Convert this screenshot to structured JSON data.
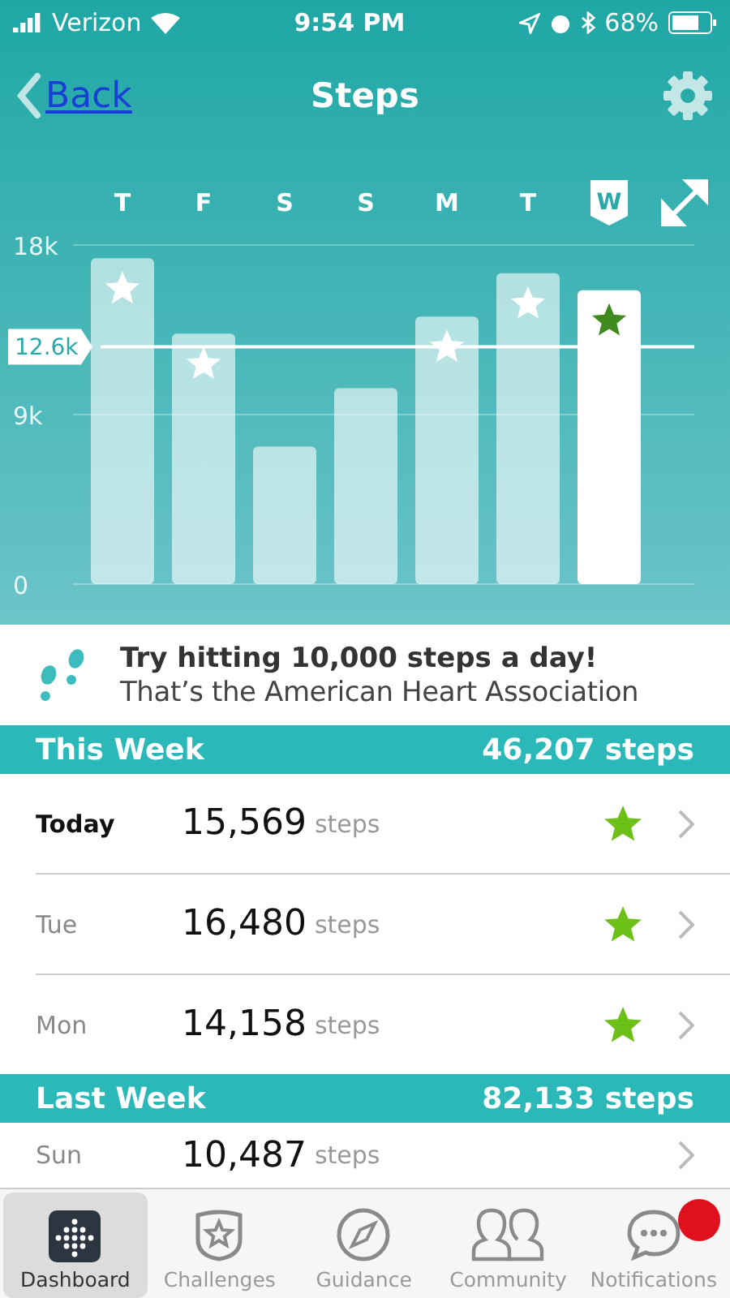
{
  "status_bar": {
    "carrier": "Verizon",
    "time": "9:54 PM",
    "battery": "68%"
  },
  "nav": {
    "back": "Back",
    "title": "Steps"
  },
  "chart_data": {
    "type": "bar",
    "categories": [
      "T",
      "F",
      "S",
      "S",
      "M",
      "T",
      "W"
    ],
    "values": [
      17300,
      13300,
      7300,
      10400,
      14200,
      16500,
      15600
    ],
    "ylim": [
      0,
      18000
    ],
    "yticks": [
      {
        "value": 0,
        "label": "0"
      },
      {
        "value": 9000,
        "label": "9k"
      },
      {
        "value": 18000,
        "label": "18k"
      }
    ],
    "ref_lines": [
      {
        "value": 12600,
        "label": "12.6k",
        "axis": "y"
      }
    ]
  },
  "bars": [
    {
      "selected": false,
      "goal_met": true
    },
    {
      "selected": false,
      "goal_met": true
    },
    {
      "selected": false,
      "goal_met": false
    },
    {
      "selected": false,
      "goal_met": false
    },
    {
      "selected": false,
      "goal_met": true
    },
    {
      "selected": false,
      "goal_met": true
    },
    {
      "selected": true,
      "goal_met": true
    }
  ],
  "tip": {
    "title": "Try hitting 10,000 steps a day!",
    "subtitle": "That’s the American Heart Association"
  },
  "sections": [
    {
      "title": "This Week",
      "total": "46,207 steps",
      "rows": [
        {
          "day": "Today",
          "steps": "15,569",
          "unit": "steps",
          "emphasized": true,
          "goal_met": true
        },
        {
          "day": "Tue",
          "steps": "16,480",
          "unit": "steps",
          "emphasized": false,
          "goal_met": true
        },
        {
          "day": "Mon",
          "steps": "14,158",
          "unit": "steps",
          "emphasized": false,
          "goal_met": true
        }
      ]
    },
    {
      "title": "Last Week",
      "total": "82,133 steps",
      "rows": [
        {
          "day": "Sun",
          "steps": "10,487",
          "unit": "steps",
          "emphasized": false,
          "goal_met": false
        }
      ]
    }
  ],
  "tabs": [
    {
      "label": "Dashboard",
      "selected": true,
      "badge": false
    },
    {
      "label": "Challenges",
      "selected": false,
      "badge": false
    },
    {
      "label": "Guidance",
      "selected": false,
      "badge": false
    },
    {
      "label": "Community",
      "selected": false,
      "badge": false
    },
    {
      "label": "Notifications",
      "selected": false,
      "badge": true
    }
  ]
}
